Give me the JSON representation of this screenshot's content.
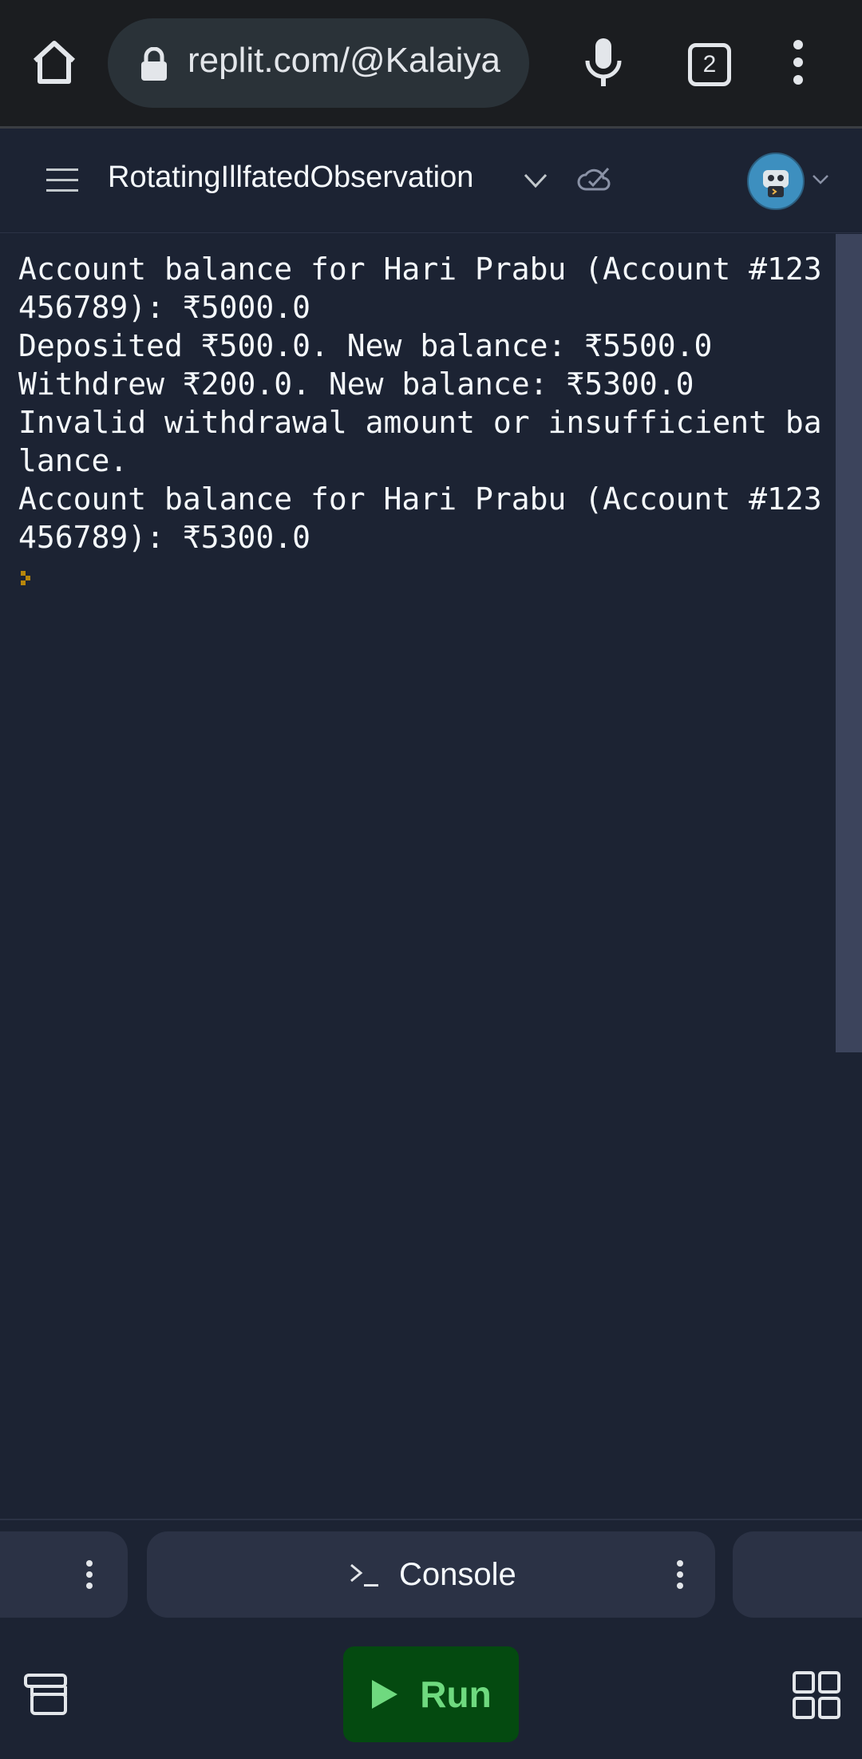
{
  "browser": {
    "url": "replit.com/@Kalaiya",
    "tab_count": "2"
  },
  "header": {
    "repl_name": "RotatingIllfatedObservation"
  },
  "console": {
    "lines": [
      "Account balance for Hari Prabu (Account #123",
      "456789): ₹5000.0",
      "Deposited ₹500.0. New balance: ₹5500.0",
      "Withdrew ₹200.0. New balance: ₹5300.0",
      "Invalid withdrawal amount or insufficient ba",
      "lance.",
      "Account balance for Hari Prabu (Account #123",
      "456789): ₹5300.0"
    ]
  },
  "tabs": {
    "console_label": "Console"
  },
  "toolbar": {
    "run_label": "Run"
  },
  "colors": {
    "background": "#1c2333",
    "surface": "#2b3245",
    "run_bg": "#044a10",
    "run_text": "#6fd97f",
    "text": "#f5f9fc"
  },
  "icons": [
    "home-icon",
    "lock-icon",
    "microphone-icon",
    "tabs-counter-icon",
    "more-vertical-icon",
    "hamburger-menu-icon",
    "chevron-down-icon",
    "cloud-check-icon",
    "avatar",
    "console-prompt-icon",
    "play-icon",
    "layers-icon",
    "grid-icon"
  ]
}
